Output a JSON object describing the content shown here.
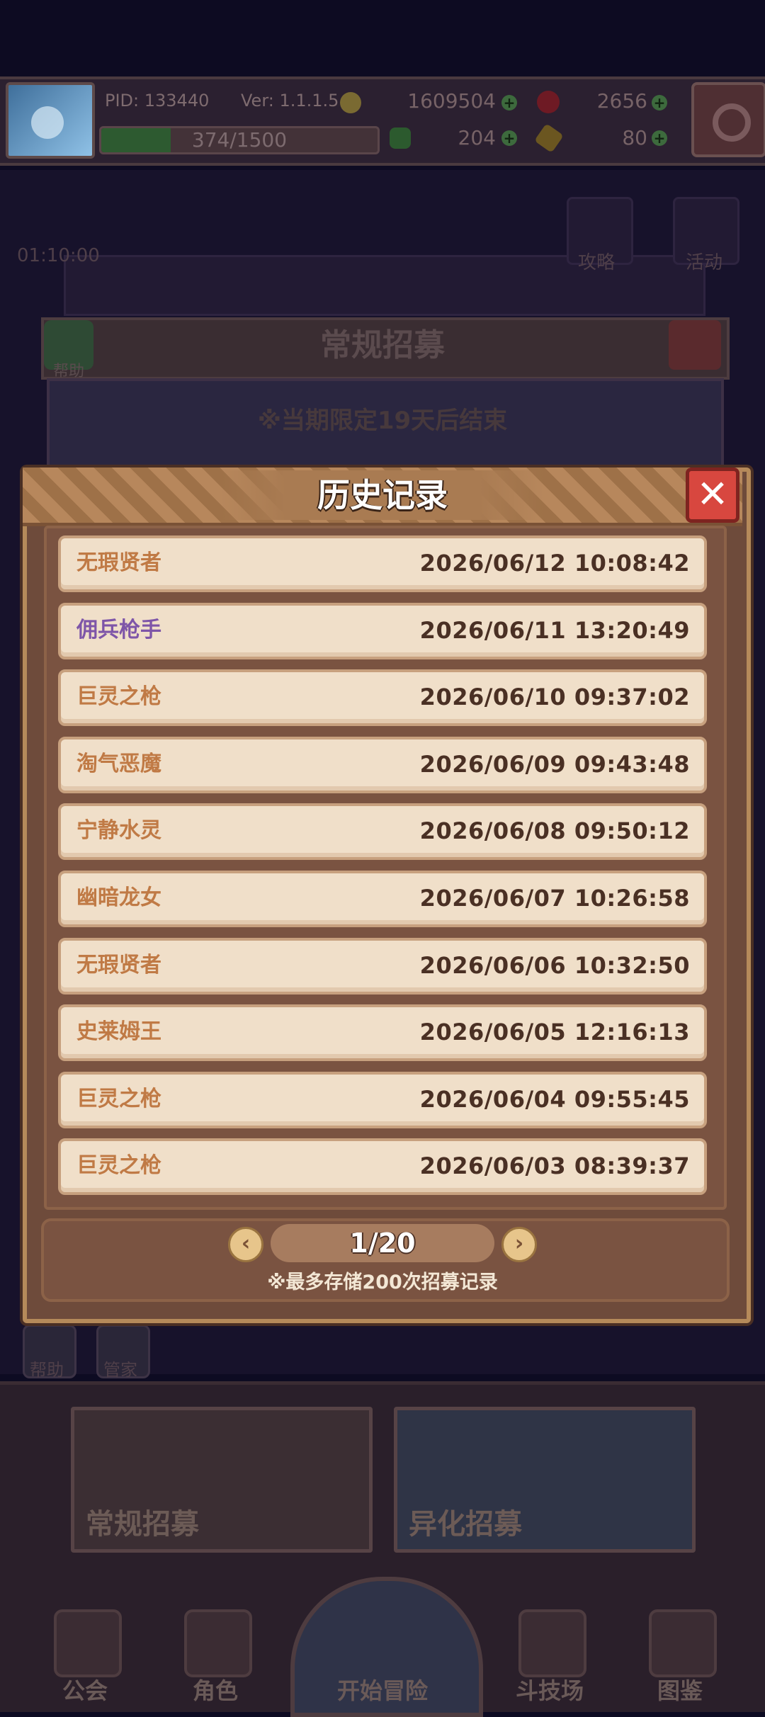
{
  "status_bar": {
    "pid": "PID: 133440",
    "version": "Ver: 1.1.1.5",
    "gold": "1609504",
    "gems": "2656",
    "energy": "374/1500",
    "energy_fraction": 0.25,
    "clover": "204",
    "keys": "80"
  },
  "background": {
    "timer": "01:10:00",
    "guide_label": "攻略",
    "event_label": "活动",
    "recruit_title": "常规招募",
    "help_label": "帮助",
    "limited_notice": "※当期限定19天后结束",
    "side_labels": [
      "帮助",
      "管家"
    ]
  },
  "modal": {
    "title": "历史记录",
    "records": [
      {
        "name": "无瑕贤者",
        "time": "2026/06/12 10:08:42",
        "color": "#c07a45"
      },
      {
        "name": "佣兵枪手",
        "time": "2026/06/11 13:20:49",
        "color": "#7e55a8"
      },
      {
        "name": "巨灵之枪",
        "time": "2026/06/10 09:37:02",
        "color": "#c07a45"
      },
      {
        "name": "淘气恶魔",
        "time": "2026/06/09 09:43:48",
        "color": "#c07a45"
      },
      {
        "name": "宁静水灵",
        "time": "2026/06/08 09:50:12",
        "color": "#c07a45"
      },
      {
        "name": "幽暗龙女",
        "time": "2026/06/07 10:26:58",
        "color": "#c07a45"
      },
      {
        "name": "无瑕贤者",
        "time": "2026/06/06 10:32:50",
        "color": "#c07a45"
      },
      {
        "name": "史莱姆王",
        "time": "2026/06/05 12:16:13",
        "color": "#c07a45"
      },
      {
        "name": "巨灵之枪",
        "time": "2026/06/04 09:55:45",
        "color": "#c07a45"
      },
      {
        "name": "巨灵之枪",
        "time": "2026/06/03 08:39:37",
        "color": "#c07a45"
      }
    ],
    "page": "1/20",
    "note": "※最多存储200次招募记录"
  },
  "cards": [
    "常规招募",
    "异化招募"
  ],
  "nav": [
    "公会",
    "角色",
    "开始冒险",
    "斗技场",
    "图鉴"
  ],
  "colors": {
    "accent": "#d8473f",
    "panel": "#6e4b3b",
    "row_bg": "#f0dfc9"
  }
}
